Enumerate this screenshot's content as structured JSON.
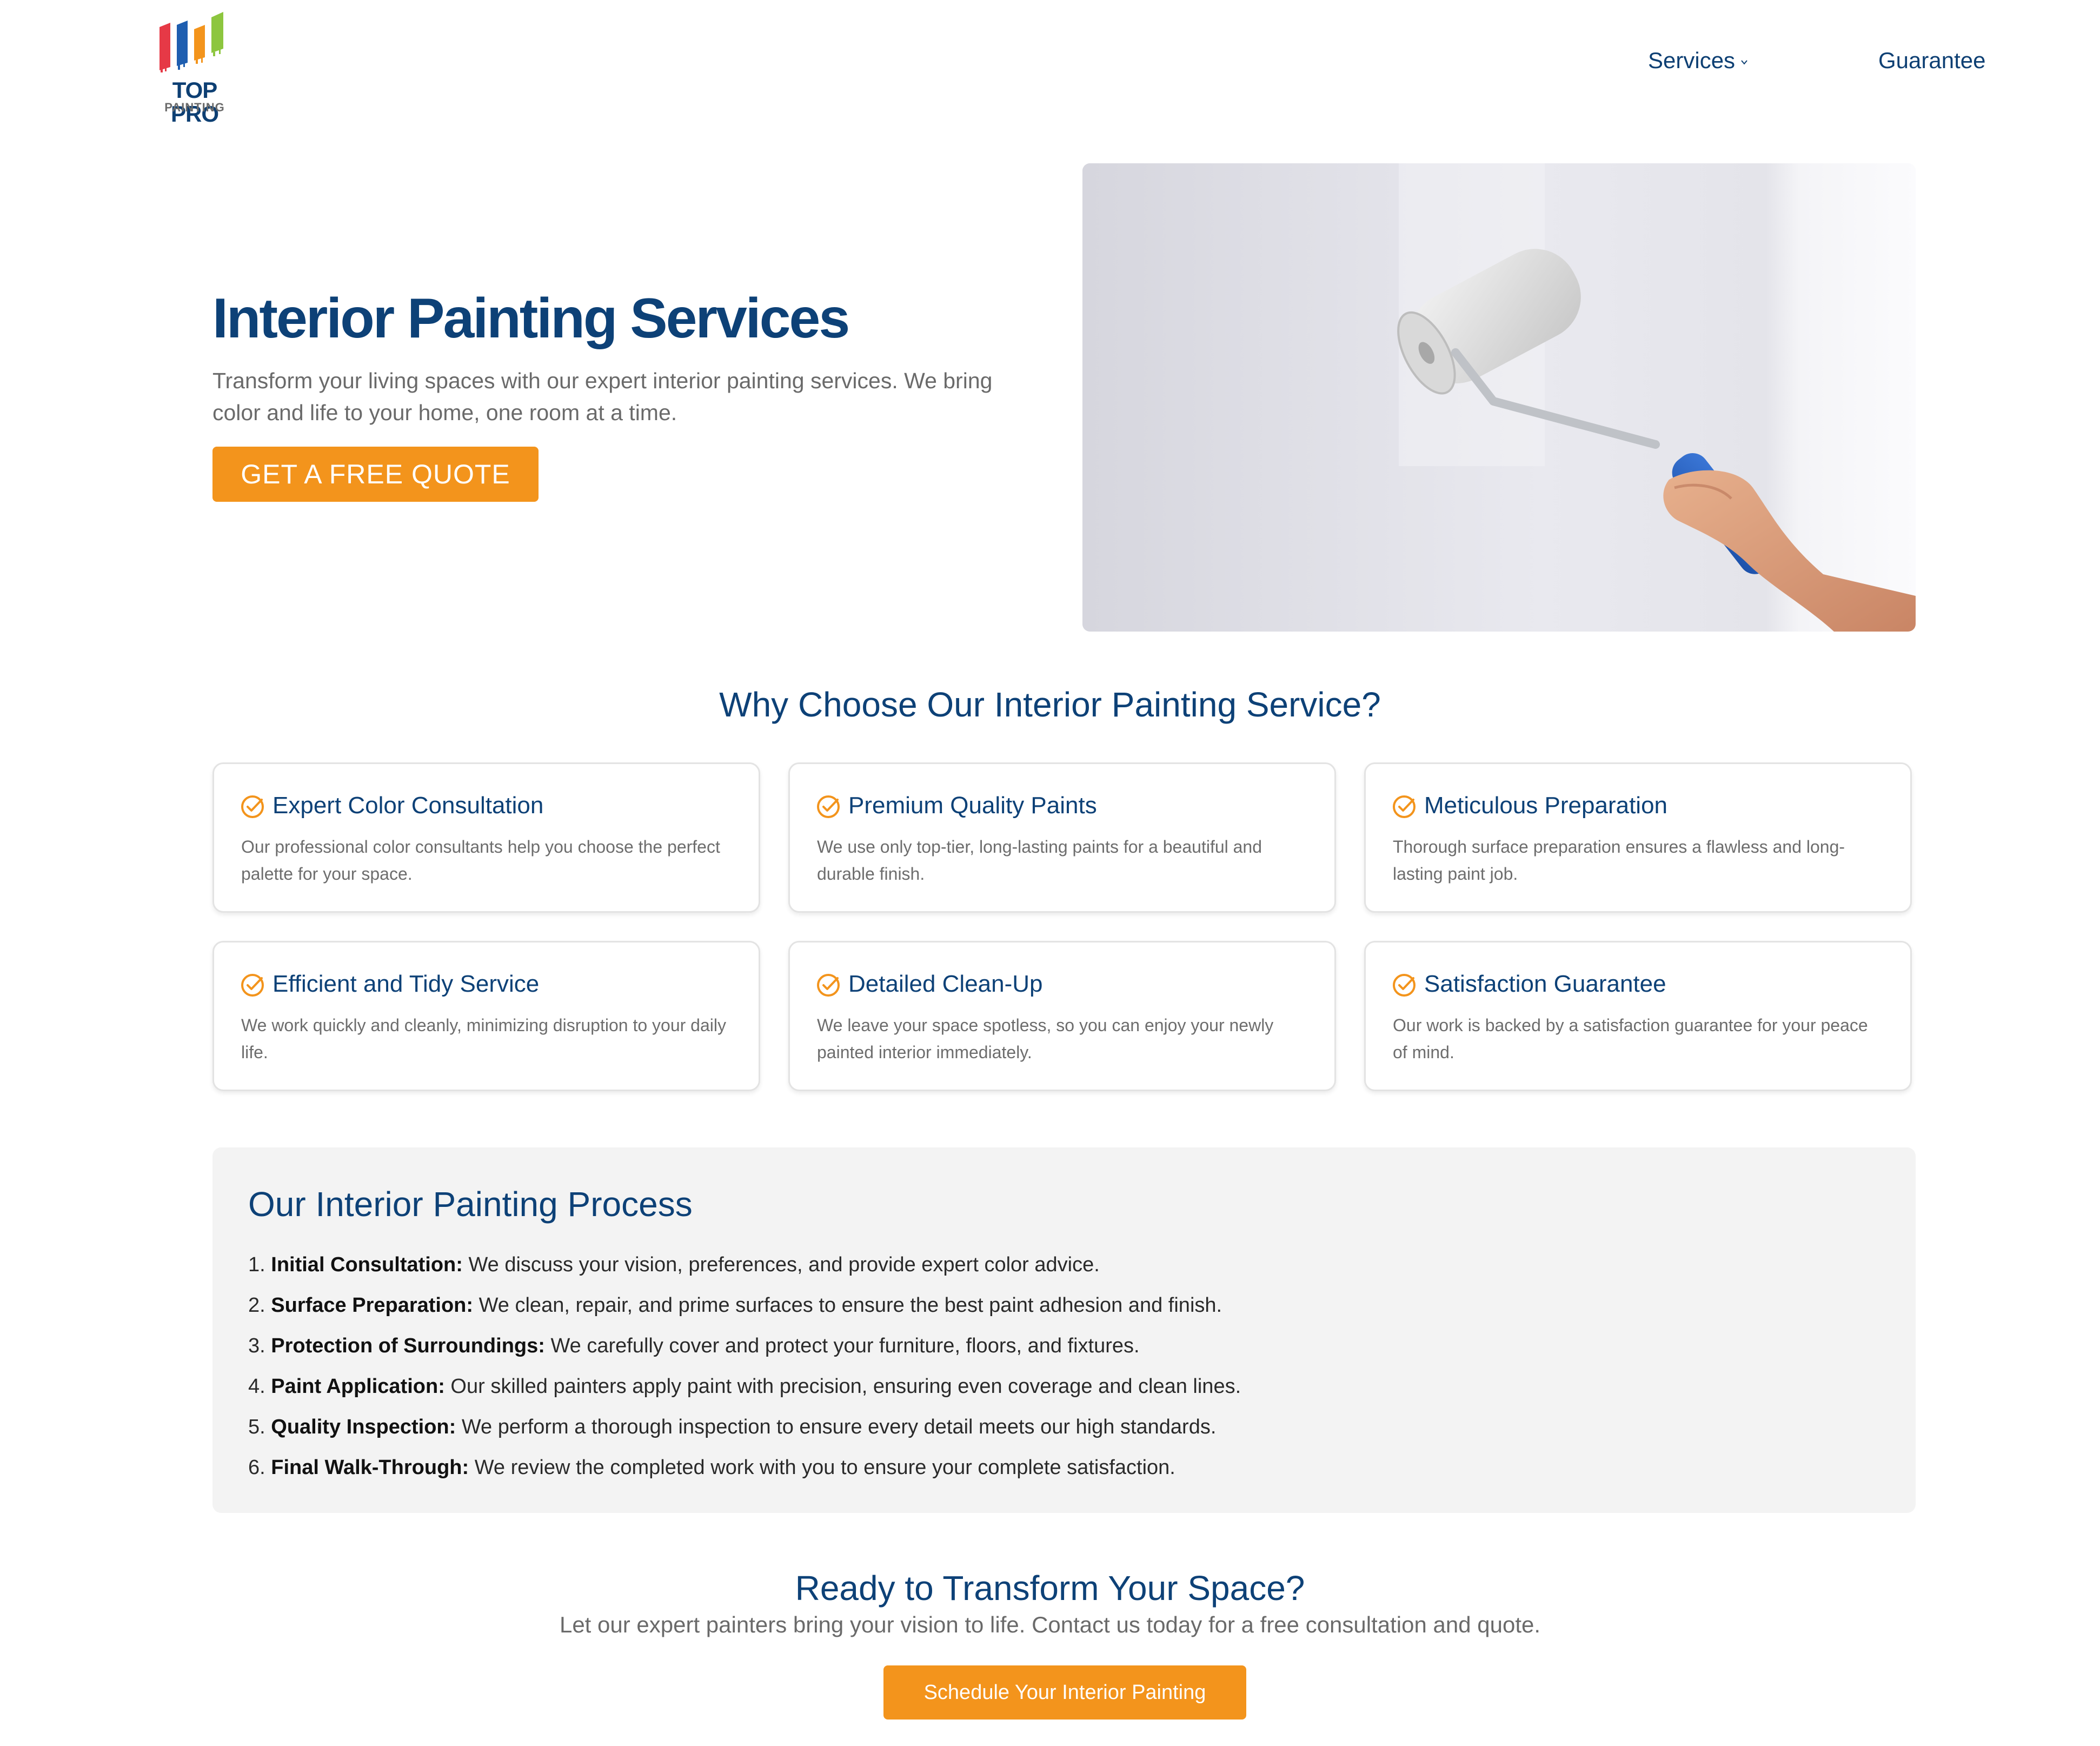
{
  "brand": {
    "name": "TOP PRO",
    "sub": "PAINTING",
    "colors": [
      "#e63946",
      "#1e5eb0",
      "#f3941c",
      "#8dc63f"
    ]
  },
  "nav": {
    "items": [
      {
        "label": "Services",
        "has_dropdown": true
      },
      {
        "label": "Guarantee",
        "has_dropdown": false
      }
    ]
  },
  "hero": {
    "title": "Interior Painting Services",
    "subtitle": "Transform your living spaces with our expert interior painting services. We bring color and life to your home, one room at a time.",
    "cta_label": "GET A FREE QUOTE"
  },
  "why": {
    "title": "Why Choose Our Interior Painting Service?",
    "features": [
      {
        "title": "Expert Color Consultation",
        "text": "Our professional color consultants help you choose the perfect palette for your space."
      },
      {
        "title": "Premium Quality Paints",
        "text": "We use only top-tier, long-lasting paints for a beautiful and durable finish."
      },
      {
        "title": "Meticulous Preparation",
        "text": "Thorough surface preparation ensures a flawless and long-lasting paint job."
      },
      {
        "title": "Efficient and Tidy Service",
        "text": "We work quickly and cleanly, minimizing disruption to your daily life."
      },
      {
        "title": "Detailed Clean-Up",
        "text": "We leave your space spotless, so you can enjoy your newly painted interior immediately."
      },
      {
        "title": "Satisfaction Guarantee",
        "text": "Our work is backed by a satisfaction guarantee for your peace of mind."
      }
    ]
  },
  "process": {
    "title": "Our Interior Painting Process",
    "steps": [
      {
        "num": "1.",
        "label": "Initial Consultation:",
        "text": " We discuss your vision, preferences, and provide expert color advice."
      },
      {
        "num": "2.",
        "label": "Surface Preparation:",
        "text": " We clean, repair, and prime surfaces to ensure the best paint adhesion and finish."
      },
      {
        "num": "3.",
        "label": "Protection of Surroundings:",
        "text": " We carefully cover and protect your furniture, floors, and fixtures."
      },
      {
        "num": "4.",
        "label": "Paint Application:",
        "text": " Our skilled painters apply paint with precision, ensuring even coverage and clean lines."
      },
      {
        "num": "5.",
        "label": "Quality Inspection:",
        "text": " We perform a thorough inspection to ensure every detail meets our high standards."
      },
      {
        "num": "6.",
        "label": "Final Walk-Through:",
        "text": " We review the completed work with you to ensure your complete satisfaction."
      }
    ]
  },
  "cta": {
    "title": "Ready to Transform Your Space?",
    "subtitle": "Let our expert painters bring your vision to life. Contact us today for a free consultation and quote.",
    "button_label": "Schedule Your Interior Painting"
  },
  "theme": {
    "primary": "#0d4177",
    "accent": "#f3941c",
    "muted_text": "#6a6a6a",
    "panel_bg": "#f3f3f3"
  },
  "icons": {
    "feature_icon": "check-circle-icon",
    "dropdown_icon": "chevron-down-icon"
  }
}
